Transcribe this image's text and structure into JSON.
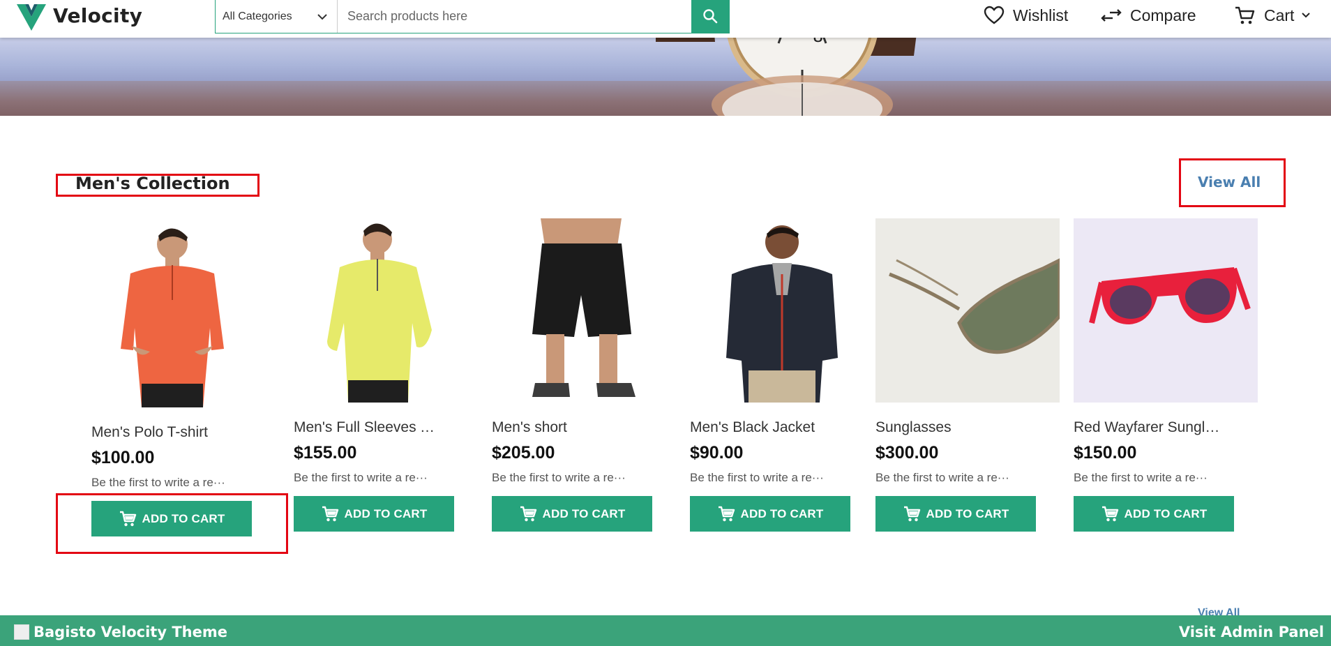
{
  "header": {
    "brand": "Velocity",
    "search": {
      "category": "All Categories",
      "placeholder": "Search products here"
    },
    "nav": {
      "wishlist": "Wishlist",
      "compare": "Compare",
      "cart": "Cart"
    }
  },
  "collection": {
    "title": "Men's Collection",
    "view_all": "View All",
    "products": [
      {
        "name": "Men's Polo T-shirt",
        "price": "$100.00",
        "review": "Be the first to write a re···",
        "button": "ADD TO CART"
      },
      {
        "name": "Men's Full Sleeves T-...",
        "price": "$155.00",
        "review": "Be the first to write a re···",
        "button": "ADD TO CART"
      },
      {
        "name": "Men's short",
        "price": "$205.00",
        "review": "Be the first to write a re···",
        "button": "ADD TO CART"
      },
      {
        "name": "Men's Black Jacket",
        "price": "$90.00",
        "review": "Be the first to write a re···",
        "button": "ADD TO CART"
      },
      {
        "name": "Sunglasses",
        "price": "$300.00",
        "review": "Be the first to write a re···",
        "button": "ADD TO CART"
      },
      {
        "name": "Red Wayfarer Sungla...",
        "price": "$150.00",
        "review": "Be the first to write a re···",
        "button": "ADD TO CART"
      }
    ]
  },
  "footer": {
    "brand": "Bagisto Velocity Theme",
    "admin_link": "Visit Admin Panel",
    "peek_text": "View All"
  },
  "colors": {
    "accent": "#26a37c",
    "footer": "#3ba37a",
    "highlight": "#e30613",
    "link": "#4a7fb0"
  },
  "icons": [
    "velocity-logo-icon",
    "chevron-down-icon",
    "search-icon",
    "heart-icon",
    "compare-icon",
    "cart-icon"
  ]
}
